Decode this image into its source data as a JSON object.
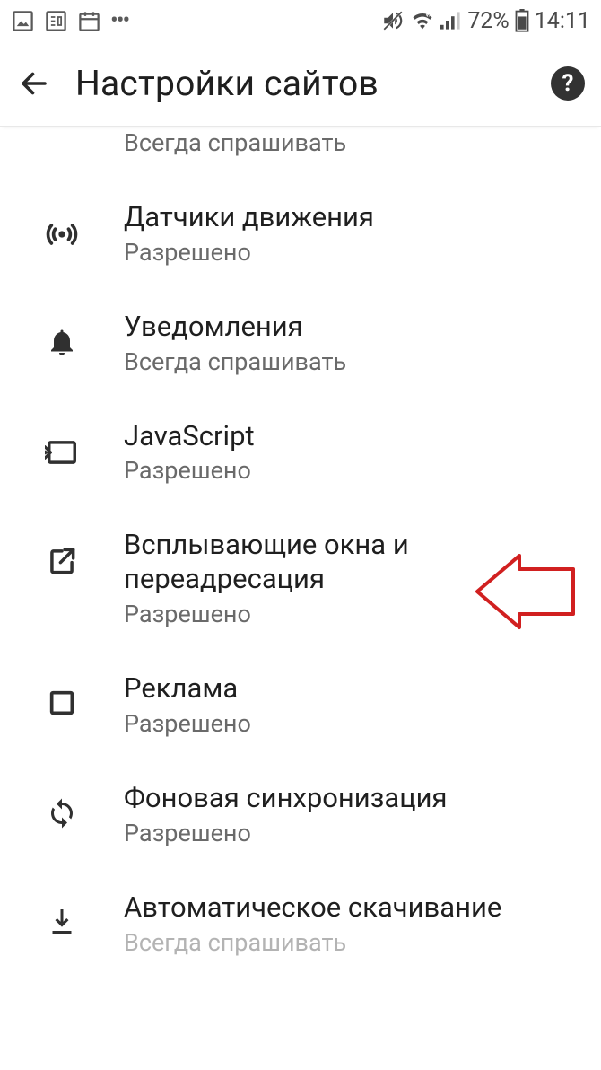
{
  "status": {
    "battery_pct": "72%",
    "time": "14:11"
  },
  "header": {
    "title": "Настройки сайтов"
  },
  "partial_top": {
    "sub": "Всегда спрашивать"
  },
  "items": [
    {
      "title": "Датчики движения",
      "sub": "Разрешено"
    },
    {
      "title": "Уведомления",
      "sub": "Всегда спрашивать"
    },
    {
      "title": "JavaScript",
      "sub": "Разрешено"
    },
    {
      "title": "Всплывающие окна и переадресация",
      "sub": "Разрешено"
    },
    {
      "title": "Реклама",
      "sub": "Разрешено"
    },
    {
      "title": "Фоновая синхронизация",
      "sub": "Разрешено"
    }
  ],
  "partial_bottom": {
    "title": "Автоматическое скачивание",
    "sub": "Всегда спрашивать"
  }
}
